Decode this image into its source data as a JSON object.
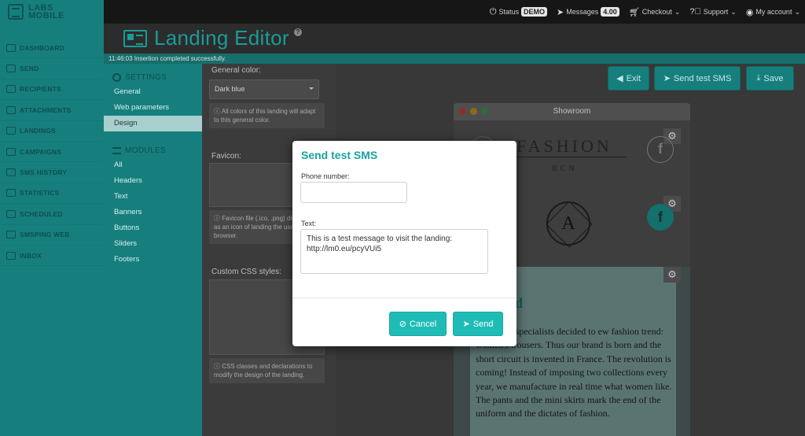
{
  "topbar": {
    "logo_text": "LABS MOBILE",
    "status_label": "Status",
    "status_value": "DEMO",
    "messages_label": "Messages",
    "messages_value": "4.00",
    "checkout_label": "Checkout",
    "support_label": "Support",
    "account_label": "My account"
  },
  "sidebar": {
    "items": [
      {
        "label": "DASHBOARD",
        "icon": "dashboard-icon"
      },
      {
        "label": "SEND",
        "icon": "envelope-icon"
      },
      {
        "label": "RECIPIENTS",
        "icon": "address-book-icon"
      },
      {
        "label": "ATTACHMENTS",
        "icon": "paperclip-icon"
      },
      {
        "label": "LANDINGS",
        "icon": "newspaper-icon"
      },
      {
        "label": "CAMPAIGNS",
        "icon": "box-icon"
      },
      {
        "label": "SMS HISTORY",
        "icon": "search-icon"
      },
      {
        "label": "STATISTICS",
        "icon": "bar-chart-icon"
      },
      {
        "label": "SCHEDULED",
        "icon": "clock-icon"
      },
      {
        "label": "SMSPING WEB",
        "icon": "signal-icon"
      },
      {
        "label": "INBOX",
        "icon": "inbox-icon"
      }
    ]
  },
  "header": {
    "title": "Landing Editor",
    "help": "?",
    "notice": "11:46:03 Insertion completed successfully."
  },
  "settings_menu": {
    "settings_heading": "SETTINGS",
    "settings_items": [
      "General",
      "Web parameters",
      "Design"
    ],
    "active_item": "Design",
    "modules_heading": "MODULES",
    "module_items": [
      "All",
      "Headers",
      "Text",
      "Banners",
      "Buttons",
      "Sliders",
      "Footers"
    ]
  },
  "form": {
    "general_color_label": "General color:",
    "general_color_value": "Dark blue",
    "general_color_hint": "All colors of this landing will adapt to this general color.",
    "favicon_label": "Favicon:",
    "favicon_hint": "Favicon file (.ico, .png) displayed as an icon of landing the user's browser.",
    "css_label": "Custom CSS styles:",
    "css_hint": "CSS classes and declarations to modify the design of the landing."
  },
  "toolbar": {
    "exit_label": "Exit",
    "send_test_label": "Send test SMS",
    "save_label": "Save"
  },
  "preview": {
    "window_title": "Showroom",
    "brand_name": "FASHION",
    "brand_sub": "BCN",
    "seal_letter": "A",
    "story_heading": "d",
    "story_text": "ree textile specialists decided to ew fashion trend: women's trousers. Thus our brand is born and the short circuit is invented in France. The revolution is coming! Instead of imposing two collections every year, we manufacture in real time what women like. The pants and the mini skirts mark the end of the uniform and the dictates of fashion."
  },
  "modal": {
    "title": "Send test SMS",
    "phone_label": "Phone number:",
    "phone_value": "",
    "text_label": "Text:",
    "text_value": "This is a test message to visit the landing: http://lm0.eu/pcyVUi5",
    "cancel_label": "Cancel",
    "send_label": "Send"
  },
  "colors": {
    "teal": "#167f7d",
    "accent": "#1fbcb7",
    "title_teal": "#1a9b98"
  }
}
